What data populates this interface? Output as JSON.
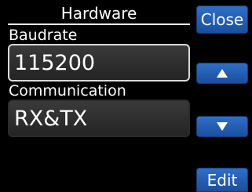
{
  "page": {
    "title": "Hardware"
  },
  "fields": {
    "baudrate": {
      "label": "Baudrate",
      "value": "115200"
    },
    "communication": {
      "label": "Communication",
      "value": "RX&TX"
    }
  },
  "buttons": {
    "close_label": "Close",
    "up_icon": "arrow-up-icon",
    "down_icon": "arrow-down-icon",
    "edit_label": "Edit"
  },
  "colors": {
    "background": "#000000",
    "button_blue": "#1f5bb5",
    "field_bg": "#2e2e2e",
    "selected_border": "#d9d9d9",
    "text": "#ffffff"
  }
}
